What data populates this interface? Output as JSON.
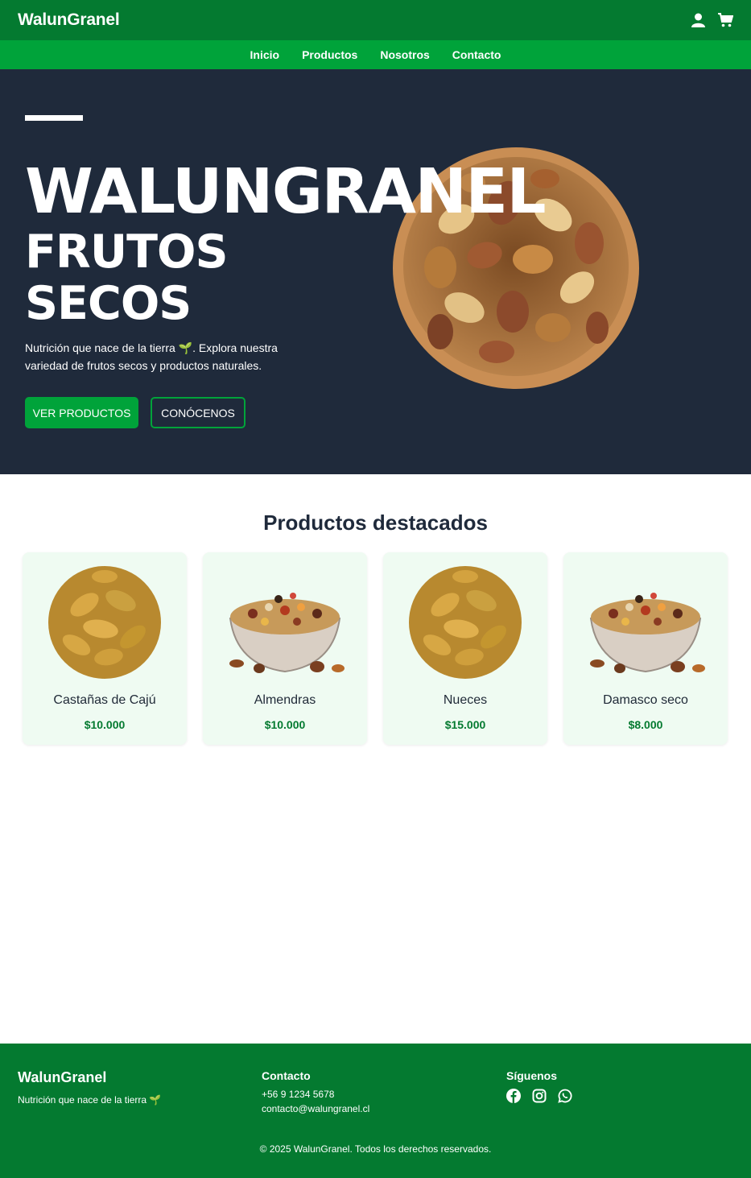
{
  "header": {
    "brand": "WalunGranel",
    "icons": [
      "user-icon",
      "cart-icon"
    ]
  },
  "nav": {
    "items": [
      "Inicio",
      "Productos",
      "Nosotros",
      "Contacto"
    ]
  },
  "hero": {
    "title_line1": "WALUNGRANEL",
    "title_line2": "FRUTOS",
    "title_line3": "SECOS",
    "description": "Nutrición que nace de la tierra 🌱. Explora nuestra variedad de frutos secos y productos naturales.",
    "primary_button": "VER PRODUCTOS",
    "secondary_button": "CONÓCENOS"
  },
  "featured": {
    "title": "Productos destacados",
    "products": [
      {
        "name": "Castañas de Cajú",
        "price": "$10.000"
      },
      {
        "name": "Almendras",
        "price": "$10.000"
      },
      {
        "name": "Nueces",
        "price": "$15.000"
      },
      {
        "name": "Damasco seco",
        "price": "$8.000"
      }
    ]
  },
  "footer": {
    "brand": "WalunGranel",
    "tagline": "Nutrición que nace de la tierra 🌱",
    "contact_title": "Contacto",
    "phone": "+56 9 1234 5678",
    "email": "contacto@walungranel.cl",
    "social_title": "Síguenos",
    "social_icons": [
      "facebook-icon",
      "instagram-icon",
      "whatsapp-icon"
    ],
    "copyright": "© 2025 WalunGranel. Todos los derechos reservados."
  },
  "colors": {
    "header_green": "#047a30",
    "nav_green": "#00a33a",
    "hero_bg": "#1f2a3b",
    "card_bg": "#effbf2"
  }
}
